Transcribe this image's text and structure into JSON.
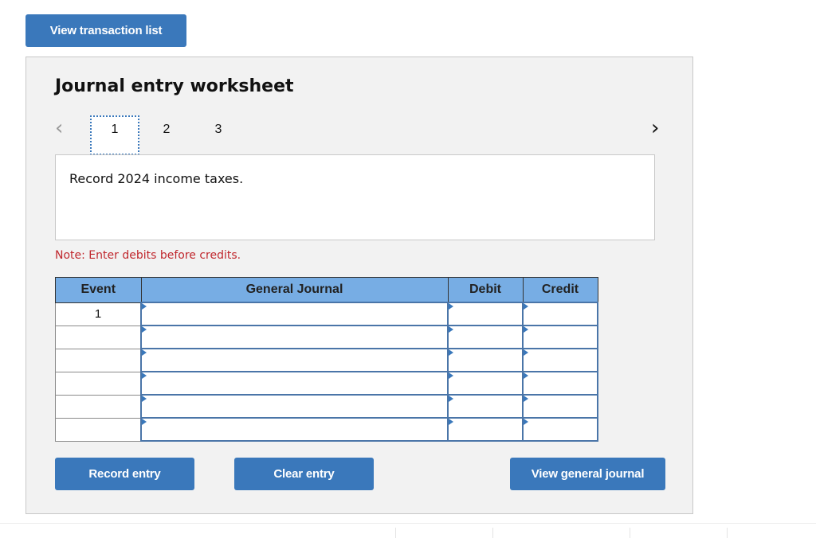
{
  "top_button": {
    "label": "View transaction list"
  },
  "worksheet": {
    "title": "Journal entry worksheet",
    "nav": {
      "prev_icon": "chevron-left-icon",
      "next_icon": "chevron-right-icon",
      "prev_glyph": "‹",
      "next_glyph": "›",
      "tabs": [
        {
          "label": "1",
          "active": true
        },
        {
          "label": "2",
          "active": false
        },
        {
          "label": "3",
          "active": false
        }
      ]
    },
    "description": "Record 2024 income taxes.",
    "note": "Note: Enter debits before credits.",
    "table": {
      "headers": {
        "event": "Event",
        "general_journal": "General Journal",
        "debit": "Debit",
        "credit": "Credit"
      },
      "rows": [
        {
          "event": "1",
          "account": "",
          "debit": "",
          "credit": ""
        },
        {
          "event": "",
          "account": "",
          "debit": "",
          "credit": ""
        },
        {
          "event": "",
          "account": "",
          "debit": "",
          "credit": ""
        },
        {
          "event": "",
          "account": "",
          "debit": "",
          "credit": ""
        },
        {
          "event": "",
          "account": "",
          "debit": "",
          "credit": ""
        },
        {
          "event": "",
          "account": "",
          "debit": "",
          "credit": ""
        }
      ]
    },
    "buttons": {
      "record": "Record entry",
      "clear": "Clear entry",
      "view_journal": "View general journal"
    }
  },
  "colors": {
    "button_blue": "#3a78bb",
    "header_blue": "#77ade4",
    "note_red": "#c0272d",
    "panel_bg": "#f2f2f2"
  }
}
